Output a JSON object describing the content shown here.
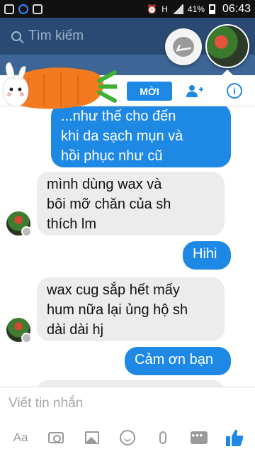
{
  "status_bar": {
    "battery_text": "41%",
    "time": "06:43",
    "network": "H"
  },
  "search": {
    "placeholder": "Tìm kiếm"
  },
  "chat_header": {
    "invite_label": "MỜI"
  },
  "messages": [
    {
      "direction": "out",
      "lines": [
        "...như thế cho đến",
        "khi da sạch mụn và",
        "hồi phục như cũ"
      ]
    },
    {
      "direction": "in",
      "lines": [
        "mình dùng wax và",
        "bôi mỡ chăn của sh",
        "thích lm"
      ]
    },
    {
      "direction": "out",
      "lines": [
        "Hihi"
      ]
    },
    {
      "direction": "in",
      "lines": [
        "wax cug sắp hết mấy",
        "hum nữa lại ủng hộ sh",
        "dài dài hj"
      ]
    },
    {
      "direction": "out",
      "lines": [
        "Cảm ơn bạn"
      ]
    }
  ],
  "composer": {
    "placeholder": "Viết tin nhắn"
  },
  "toolbar": {
    "text_style_label": "Aa"
  },
  "colors": {
    "accent": "#1e88e5",
    "incoming_bubble": "#ececec",
    "header_bg": "#2b4a73"
  },
  "icons": [
    "messenger-icon",
    "add-people-icon",
    "info-icon",
    "camera-icon",
    "image-icon",
    "emoji-icon",
    "microphone-icon",
    "more-icon",
    "like-icon"
  ]
}
